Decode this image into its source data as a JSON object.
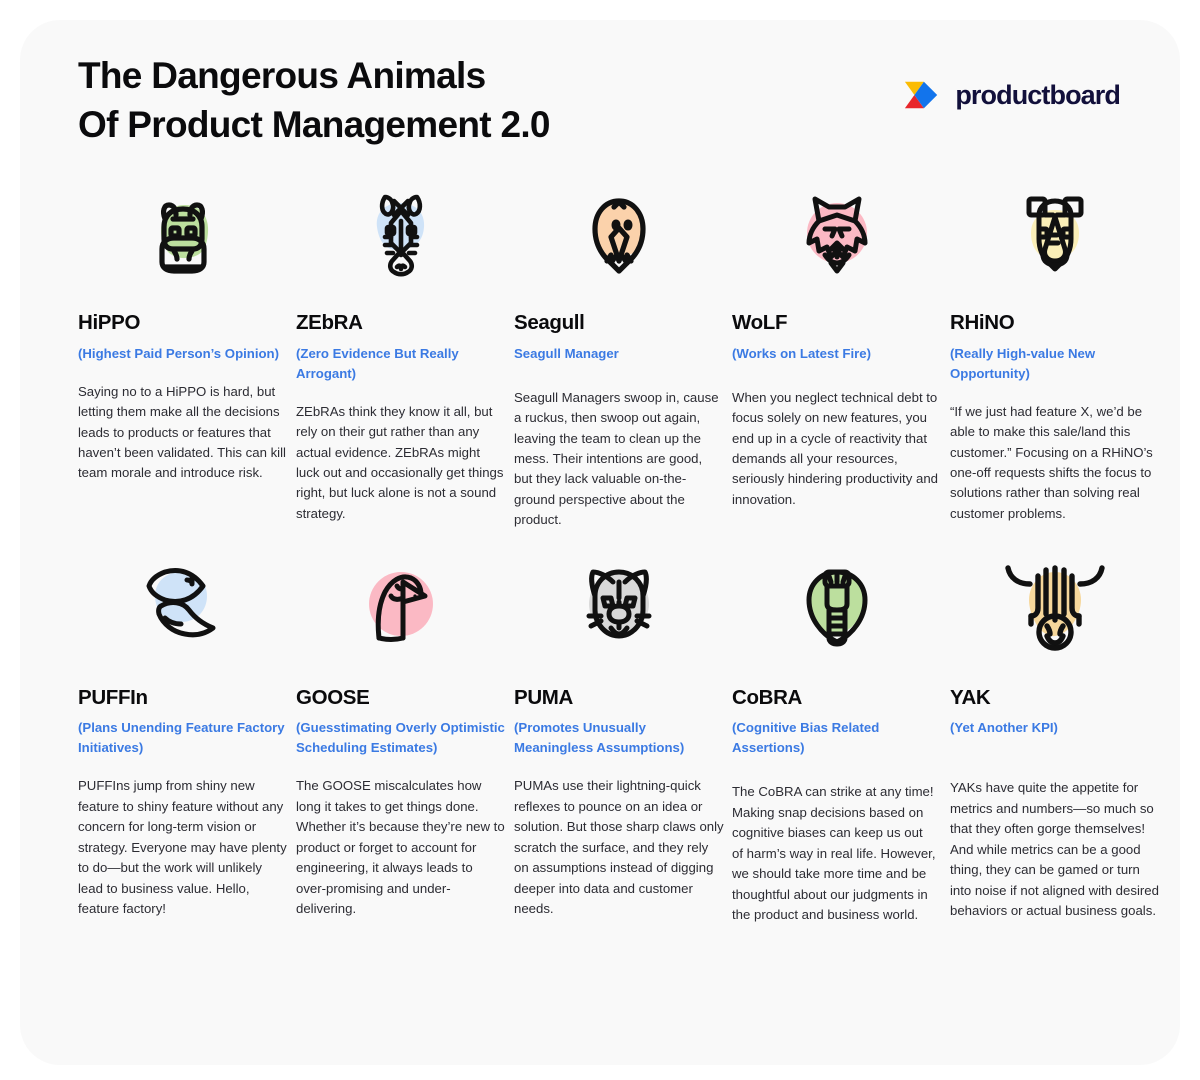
{
  "header": {
    "title": "The Dangerous Animals\nOf Product Management 2.0",
    "logo_word": "productboard",
    "logo_colors": {
      "yellow": "#fbbc04",
      "blue": "#1274ec",
      "red": "#e8262b"
    }
  },
  "theme": {
    "page_bg": "#f9f9f9",
    "outer_bg": "#ffffff",
    "title_color": "#0b0b0d",
    "subtitle_color": "#3b7ae3",
    "body_color": "#2c2c33"
  },
  "cards": [
    {
      "icon": "hippo-icon",
      "blob_color": "#bcdf9e",
      "title": "HiPPO",
      "subtitle": "(Highest Paid Person’s Opinion)",
      "body": "Saying no to a HiPPO is hard, but letting them make all the decisions leads to products or features that haven’t been validated. This can kill team morale and introduce risk."
    },
    {
      "icon": "zebra-icon",
      "blob_color": "#cfe3f8",
      "title": "ZEbRA",
      "subtitle": "(Zero Evidence But Really Arrogant)",
      "body": "ZEbRAs think they know it all, but rely on their gut rather than any actual evidence. ZEbRAs might luck out and occasionally get things right, but luck alone is not a sound strategy."
    },
    {
      "icon": "seagull-icon",
      "blob_color": "#fbd2ab",
      "title": "Seagull",
      "subtitle": "Seagull Manager",
      "body": "Seagull Managers swoop in, cause a ruckus, then swoop out again, leaving the team to clean up the mess. Their intentions are good, but they lack valuable on-the-ground perspective about the product."
    },
    {
      "icon": "wolf-icon",
      "blob_color": "#fbb9c4",
      "title": "WoLF",
      "subtitle": "(Works on Latest Fire)",
      "body": "When you neglect technical debt to focus solely on new features, you end up in a cycle of reactivity that demands all your resources, seriously hindering productivity and innovation."
    },
    {
      "icon": "rhino-icon",
      "blob_color": "#fbefb8",
      "title": "RHiNO",
      "subtitle": "(Really High-value New Opportunity)",
      "body": "“If we just had feature X, we’d be able to make this sale/land this customer.” Focusing on a RHiNO’s one-off requests shifts the focus to solutions rather than solving real customer problems."
    },
    {
      "icon": "puffin-icon",
      "blob_color": "#cfe3f8",
      "title": "PUFFIn",
      "subtitle": "(Plans Unending Feature Factory Initiatives)",
      "body": "PUFFIns jump from shiny new feature to shiny feature without any concern for long-term vision or strategy. Everyone may have plenty to do—but the work will unlikely lead to business value. Hello, feature factory!"
    },
    {
      "icon": "goose-icon",
      "blob_color": "#fbb9c4",
      "title": "GOOSE",
      "subtitle": "(Guesstimating Overly Optimistic Scheduling Estimates)",
      "body": "The GOOSE miscalculates how long it takes to get things done. Whether it’s because they’re new to product or forget to account for engineering, it always leads to over-promising and under-delivering."
    },
    {
      "icon": "puma-icon",
      "blob_color": "#d9d9d9",
      "title": "PUMA",
      "subtitle": "(Promotes Unusually Meaningless Assumptions)",
      "body": "PUMAs use their lightning-quick reflexes to pounce on an idea or solution. But those sharp claws only scratch the surface, and they rely on assumptions instead of digging deeper into data and customer needs."
    },
    {
      "icon": "cobra-icon",
      "blob_color": "#bcdf9e",
      "title": "CoBRA",
      "subtitle": "(Cognitive Bias Related Assertions)",
      "body": "The CoBRA can strike at any time! Making snap decisions based on cognitive biases can keep us out\nof harm’s way in real life. However, we should take more time and be thoughtful about our judgments in the product and business world."
    },
    {
      "icon": "yak-icon",
      "blob_color": "#f6d79b",
      "title": "YAK",
      "subtitle": "(Yet Another KPI)",
      "body": "YAKs have quite the appetite for metrics and numbers—so much so that they often gorge themselves! And while metrics can be a good thing, they can be gamed or turn into noise if not aligned with desired behaviors or actual business goals."
    }
  ]
}
